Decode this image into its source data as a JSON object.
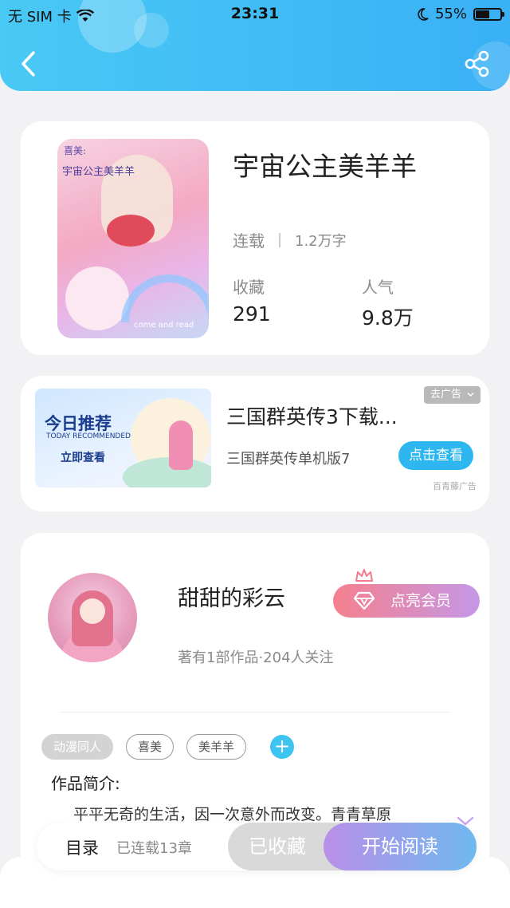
{
  "status_bar": {
    "carrier": "无 SIM 卡",
    "time": "23:31",
    "battery_text": "55%",
    "battery_level": 0.55,
    "icons": [
      "wifi-icon",
      "moon-icon",
      "battery-icon"
    ]
  },
  "header": {
    "back_icon": "chevron-left-icon",
    "share_icon": "share-icon",
    "gradient_colors": [
      "#49c9f5",
      "#3ab0f5"
    ]
  },
  "book": {
    "title": "宇宙公主美羊羊",
    "cover_text_1": "喜美:",
    "cover_text_2": "宇宙公主美羊羊",
    "cover_text_3": "come and read",
    "status": "连载",
    "word_count": "1.2万字",
    "favorites_label": "收藏",
    "favorites_value": "291",
    "popularity_label": "人气",
    "popularity_value": "9.8万"
  },
  "ad": {
    "image_title": "今日推荐",
    "image_subtitle": "TODAY RECOMMENDED",
    "image_cta": "立即查看",
    "remove_label": "去广告",
    "title": "三国群英传3下载...",
    "subtitle": "三国群英传单机版7",
    "button_label": "点击查看",
    "source": "百青藤广告",
    "accent_color": "#2db6f0"
  },
  "author": {
    "name": "甜甜的彩云",
    "meta": "著有1部作品·204人关注",
    "vip_label": "点亮会员",
    "tags": [
      "动漫同人",
      "喜美",
      "美羊羊"
    ],
    "add_tag": "+",
    "intro_label": "作品简介:",
    "intro_text": "平平无奇的生活，因一次意外而改变。青青草原"
  },
  "bottom_bar": {
    "toc_label": "目录",
    "chapter_count": "已连载13章",
    "favorited_label": "已收藏",
    "read_label": "开始阅读"
  }
}
